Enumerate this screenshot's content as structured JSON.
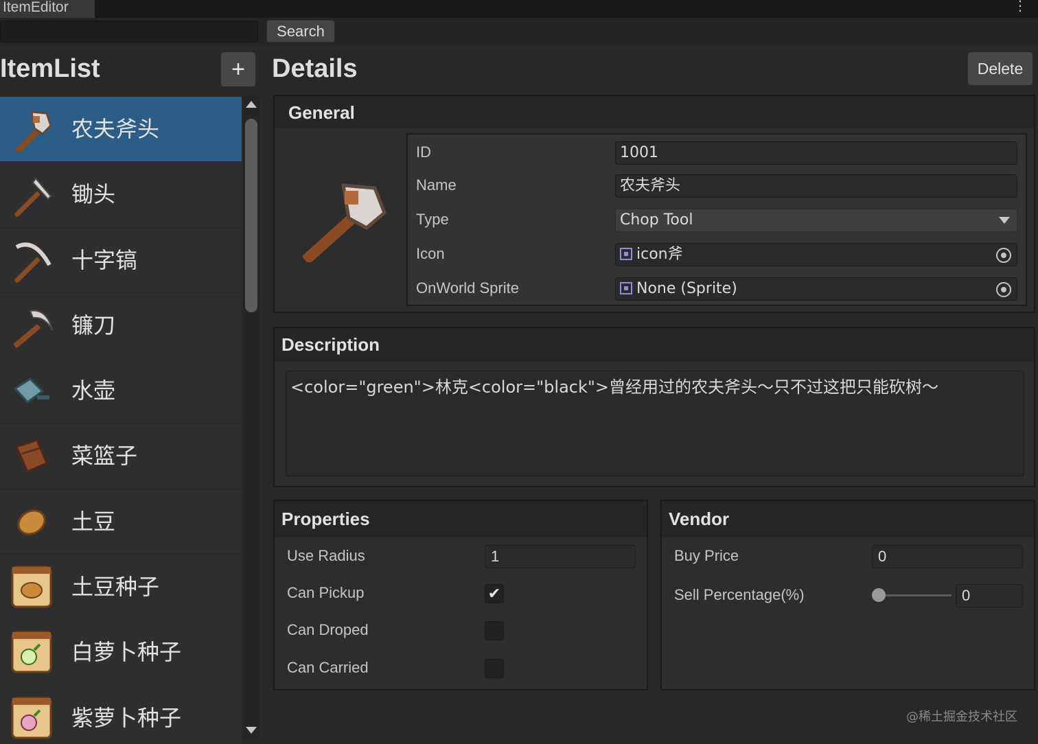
{
  "window": {
    "tab_title": "ItemEditor",
    "menu_glyph": "⋮"
  },
  "search": {
    "value": "",
    "placeholder": "",
    "button_label": "Search"
  },
  "item_list": {
    "title": "ItemList",
    "add_label": "+",
    "items": [
      {
        "label": "农夫斧头",
        "icon": "axe-icon",
        "selected": true
      },
      {
        "label": "锄头",
        "icon": "hoe-icon"
      },
      {
        "label": "十字镐",
        "icon": "pickaxe-icon"
      },
      {
        "label": "镰刀",
        "icon": "sickle-icon"
      },
      {
        "label": "水壶",
        "icon": "watering-can-icon"
      },
      {
        "label": "菜篮子",
        "icon": "basket-icon"
      },
      {
        "label": "土豆",
        "icon": "potato-icon"
      },
      {
        "label": "土豆种子",
        "icon": "potato-seed-icon"
      },
      {
        "label": "白萝卜种子",
        "icon": "white-radish-seed-icon"
      },
      {
        "label": "紫萝卜种子",
        "icon": "purple-radish-seed-icon"
      }
    ]
  },
  "details": {
    "title": "Details",
    "delete_label": "Delete",
    "general": {
      "title": "General",
      "id_label": "ID",
      "id_value": "1001",
      "name_label": "Name",
      "name_value": "农夫斧头",
      "type_label": "Type",
      "type_value": "Chop Tool",
      "icon_label": "Icon",
      "icon_value": "icon斧",
      "onworld_label": "OnWorld Sprite",
      "onworld_value": "None (Sprite)"
    },
    "description": {
      "title": "Description",
      "text": "<color=\"green\">林克<color=\"black\">曾经用过的农夫斧头～只不过这把只能砍树～"
    },
    "properties": {
      "title": "Properties",
      "use_radius_label": "Use Radius",
      "use_radius_value": "1",
      "can_pickup_label": "Can Pickup",
      "can_pickup": true,
      "can_droped_label": "Can Droped",
      "can_droped": false,
      "can_carried_label": "Can Carried",
      "can_carried": false
    },
    "vendor": {
      "title": "Vendor",
      "buy_price_label": "Buy Price",
      "buy_price_value": "0",
      "sell_percentage_label": "Sell Percentage(%)",
      "sell_percentage_value": "0"
    }
  },
  "watermark": "@稀土掘金技术社区",
  "colors": {
    "selection": "#2c5d87",
    "background": "#282828",
    "panel": "#2d2d2d"
  }
}
